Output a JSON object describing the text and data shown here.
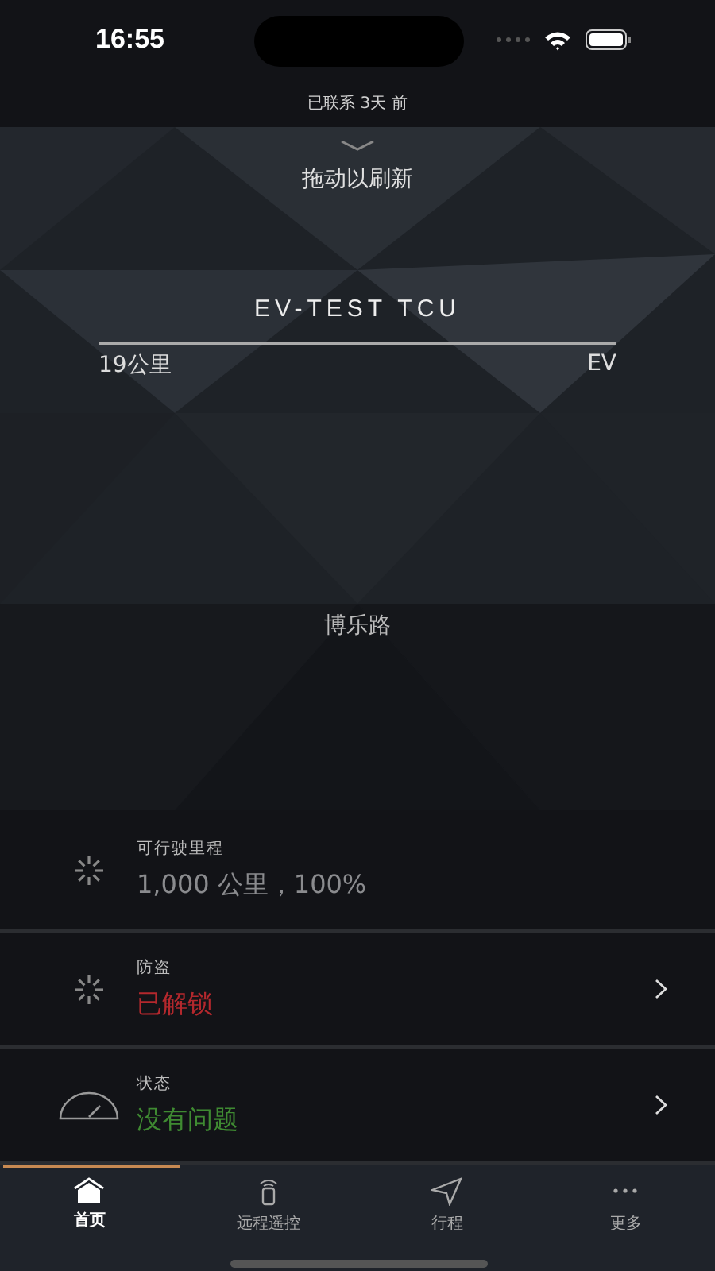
{
  "status_bar": {
    "time": "16:55"
  },
  "connection": {
    "text": "已联系 3天 前"
  },
  "hero": {
    "pull_hint": "拖动以刷新",
    "vehicle_name": "EV-TEST TCU",
    "distance": "19公里",
    "fuel_type": "EV",
    "location": "博乐路"
  },
  "rows": [
    {
      "kind": "spinner",
      "label": "可行驶里程",
      "value": "1,000 公里，100%",
      "color": "#8a8b8e",
      "navigable": false
    },
    {
      "kind": "spinner",
      "label": "防盗",
      "value": "已解锁",
      "color": "#b3282d",
      "navigable": true
    },
    {
      "kind": "gauge",
      "label": "状态",
      "value": "没有问题",
      "color": "#3f8a32",
      "navigable": true
    }
  ],
  "tabs": [
    {
      "kind": "home",
      "label": "首页",
      "selected": true
    },
    {
      "kind": "remote",
      "label": "远程遥控",
      "selected": false
    },
    {
      "kind": "trips",
      "label": "行程",
      "selected": false
    },
    {
      "kind": "more",
      "label": "更多",
      "selected": false
    }
  ]
}
